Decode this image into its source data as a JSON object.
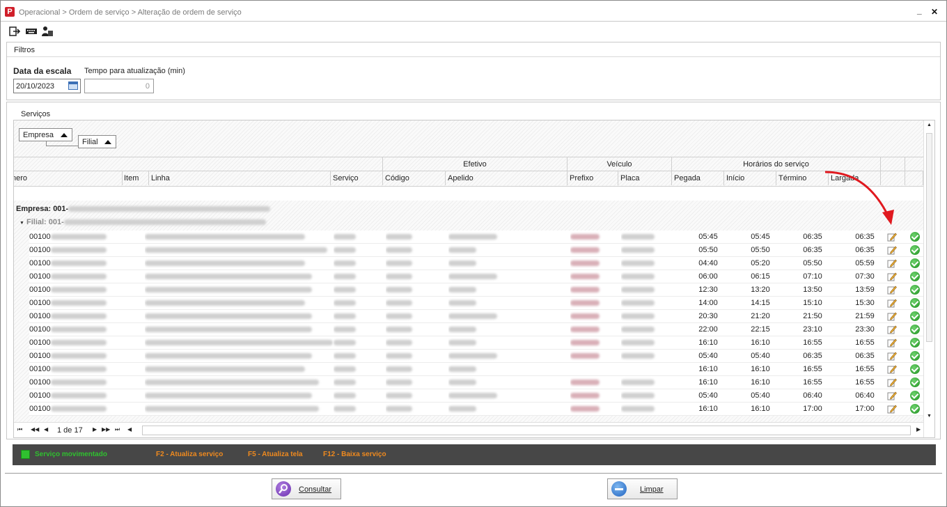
{
  "app": {
    "logo_letter": "P",
    "breadcrumb": "Operacional > Ordem de serviço > Alteração de ordem de serviço",
    "minimize": "_",
    "close": "✕"
  },
  "toolbar": {
    "icons": [
      "exit-icon",
      "keyboard-icon",
      "users-icon"
    ]
  },
  "filters": {
    "title": "Filtros",
    "date_label": "Data da escala",
    "date_value": "20/10/2023",
    "time_label": "Tempo para atualização (min)",
    "time_value": "0"
  },
  "services": {
    "title": "Serviços",
    "group_chips": [
      "Empresa",
      "Filial"
    ],
    "band_headers": {
      "efetivo": "Efetivo",
      "veiculo": "Veículo",
      "horarios": "Horários do serviço"
    },
    "columns": [
      "nero",
      "Item",
      "Linha",
      "Serviço",
      "Código",
      "Apelido",
      "Prefixo",
      "Placa",
      "Pegada",
      "Início",
      "Término",
      "Largada"
    ],
    "group_empresa": "Empresa: 001-",
    "group_filial": "Filial: 001-",
    "row_prefix": "00100",
    "rows": [
      {
        "pegada": "05:45",
        "inicio": "05:45",
        "termino": "06:35",
        "largada": "06:35"
      },
      {
        "pegada": "05:50",
        "inicio": "05:50",
        "termino": "06:35",
        "largada": "06:35"
      },
      {
        "pegada": "04:40",
        "inicio": "05:20",
        "termino": "05:50",
        "largada": "05:59"
      },
      {
        "pegada": "06:00",
        "inicio": "06:15",
        "termino": "07:10",
        "largada": "07:30"
      },
      {
        "pegada": "12:30",
        "inicio": "13:20",
        "termino": "13:50",
        "largada": "13:59"
      },
      {
        "pegada": "14:00",
        "inicio": "14:15",
        "termino": "15:10",
        "largada": "15:30"
      },
      {
        "pegada": "20:30",
        "inicio": "21:20",
        "termino": "21:50",
        "largada": "21:59"
      },
      {
        "pegada": "22:00",
        "inicio": "22:15",
        "termino": "23:10",
        "largada": "23:30"
      },
      {
        "pegada": "16:10",
        "inicio": "16:10",
        "termino": "16:55",
        "largada": "16:55"
      },
      {
        "pegada": "05:40",
        "inicio": "05:40",
        "termino": "06:35",
        "largada": "06:35"
      },
      {
        "pegada": "16:10",
        "inicio": "16:10",
        "termino": "16:55",
        "largada": "16:55"
      },
      {
        "pegada": "16:10",
        "inicio": "16:10",
        "termino": "16:55",
        "largada": "16:55"
      },
      {
        "pegada": "05:40",
        "inicio": "05:40",
        "termino": "06:40",
        "largada": "06:40"
      },
      {
        "pegada": "16:10",
        "inicio": "16:10",
        "termino": "17:00",
        "largada": "17:00"
      }
    ],
    "pager": {
      "label": "1 de 17"
    }
  },
  "legend": {
    "moved": "Serviço movimentado",
    "f2": "F2 - Atualiza serviço",
    "f5": "F5 - Atualiza tela",
    "f12": "F12 - Baixa serviço",
    "moved_color": "#2fc12f",
    "key_color": "#f08a1e"
  },
  "buttons": {
    "consultar": "Consultar",
    "limpar": "Limpar"
  }
}
